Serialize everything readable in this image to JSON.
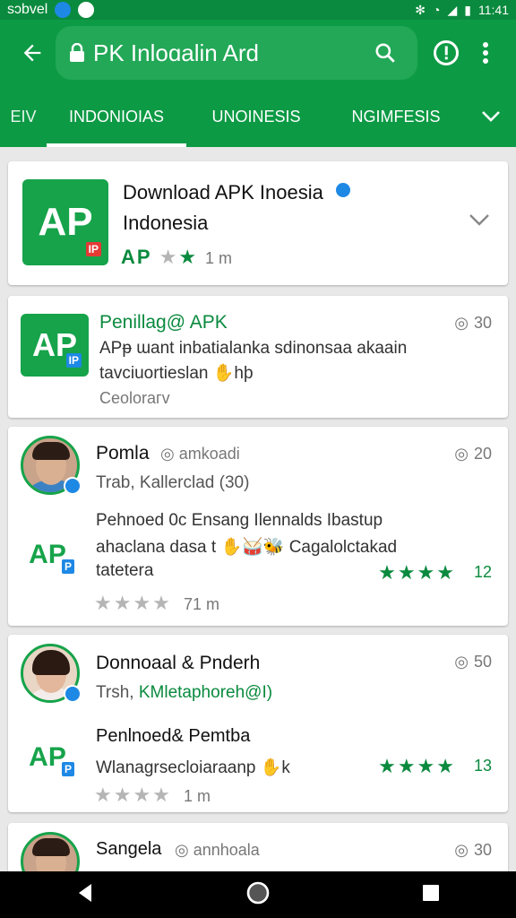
{
  "status": {
    "left_text": "sɔbvel",
    "time": "11:41"
  },
  "appbar": {
    "title": "PK Inloɑalin Ard"
  },
  "tabs": [
    {
      "label": "EIV"
    },
    {
      "label": "INDONIOIAS"
    },
    {
      "label": "UNOINESIS"
    },
    {
      "label": "NGIMFESIS"
    }
  ],
  "card1": {
    "title": "Download APK Inoesia",
    "subtitle": "Indonesia",
    "brand": "AP",
    "meta": "1 m",
    "stars_on": 2,
    "stars_total": 2
  },
  "card2": {
    "title": "Penillag@ APK",
    "line1": "APᵽ ɯant inbatialanka sdinonsaa akaain",
    "line2": "tavciuortieslan ✋hþ",
    "category": "Ceoloraгv",
    "count": "30"
  },
  "card3": {
    "name": "Pomla",
    "handle": "amkoadi",
    "sub": "Trab, Kallerclad (30)",
    "count": "20",
    "body1": "Pehnoed 0c Ensang Ilennalds Ibastup",
    "body2": "ahaclana dasa t ✋🥁🐝 Cagalolctakad",
    "body3": "tatetera",
    "rating_count": "12",
    "meta": "71 m",
    "gray_stars": 4
  },
  "card4": {
    "name": "Donnoaal & Pnderh",
    "sub_prefix": "Trsh, ",
    "sub_green": "KMletaphoreh@I)",
    "count": "50",
    "body1": "Penlnoed& Pemtba",
    "body2": "Wlanagrsecloiaraanp ✋k",
    "rating_count": "13",
    "meta": "1 m",
    "gray_stars": 4
  },
  "card5": {
    "name": "Sangela",
    "handle": "annhoala",
    "count": "30"
  },
  "colors": {
    "primary": "#0d9a45",
    "accent_green": "#0a8a3e",
    "badge_red": "#e53935",
    "badge_blue": "#1e88e5"
  }
}
